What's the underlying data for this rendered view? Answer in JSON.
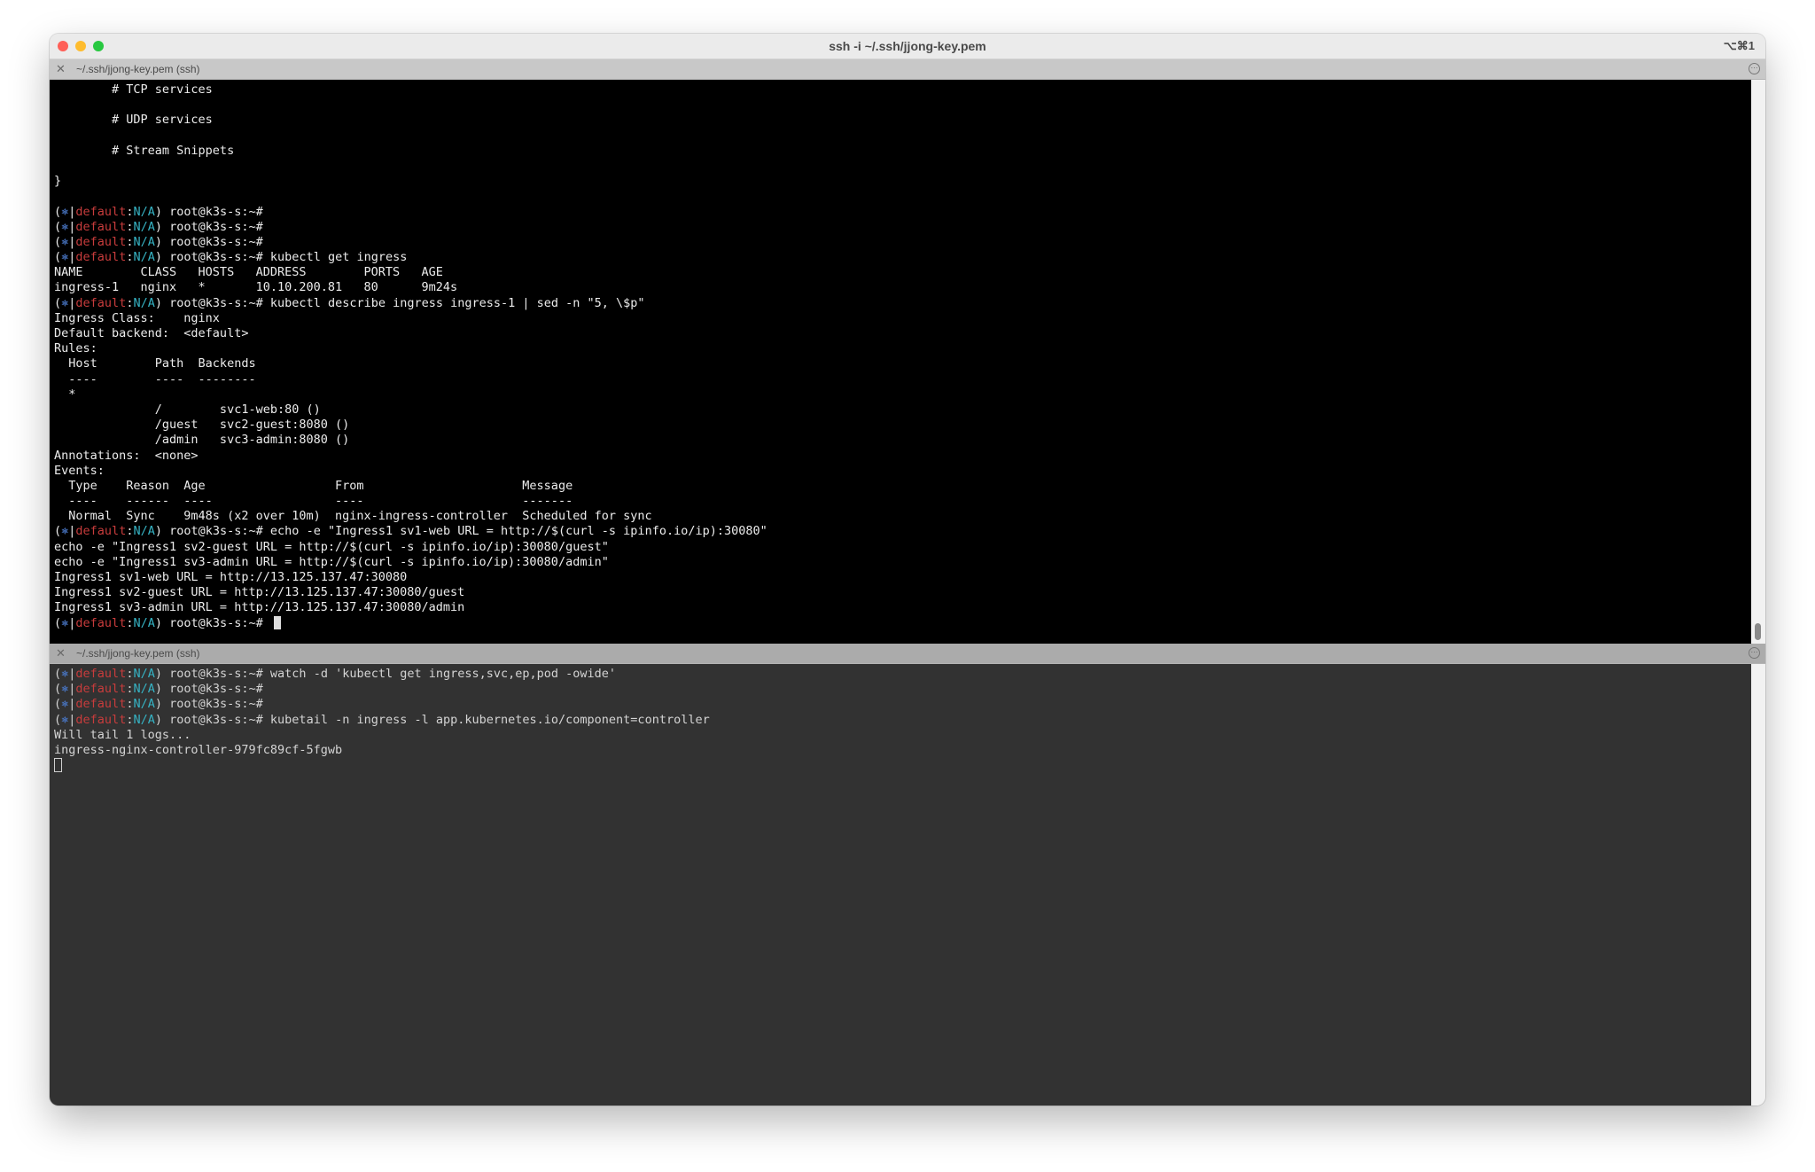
{
  "window": {
    "title": "ssh -i ~/.ssh/jjong-key.pem",
    "shortcut": "⌥⌘1"
  },
  "prompt": {
    "open": "(",
    "star": "⎈",
    "bar": "|",
    "context": "default",
    "colon": ":",
    "namespace": "N/A",
    "close": ")",
    "host": " root@k3s-s:~#"
  },
  "panes": [
    {
      "tab_label": "~/.ssh/jjong-key.pem (ssh)",
      "lines": [
        {
          "text": "        # TCP services"
        },
        {
          "text": ""
        },
        {
          "text": "        # UDP services"
        },
        {
          "text": ""
        },
        {
          "text": "        # Stream Snippets"
        },
        {
          "text": ""
        },
        {
          "text": "}"
        },
        {
          "text": ""
        },
        {
          "prompt": true,
          "text": ""
        },
        {
          "prompt": true,
          "text": ""
        },
        {
          "prompt": true,
          "text": ""
        },
        {
          "prompt": true,
          "text": " kubectl get ingress"
        },
        {
          "text": "NAME        CLASS   HOSTS   ADDRESS        PORTS   AGE"
        },
        {
          "text": "ingress-1   nginx   *       10.10.200.81   80      9m24s"
        },
        {
          "prompt": true,
          "text": " kubectl describe ingress ingress-1 | sed -n \"5, \\$p\""
        },
        {
          "text": "Ingress Class:    nginx"
        },
        {
          "text": "Default backend:  <default>"
        },
        {
          "text": "Rules:"
        },
        {
          "text": "  Host        Path  Backends"
        },
        {
          "text": "  ----        ----  --------"
        },
        {
          "text": "  *"
        },
        {
          "text": "              /        svc1-web:80 ()"
        },
        {
          "text": "              /guest   svc2-guest:8080 ()"
        },
        {
          "text": "              /admin   svc3-admin:8080 ()"
        },
        {
          "text": "Annotations:  <none>"
        },
        {
          "text": "Events:"
        },
        {
          "text": "  Type    Reason  Age                  From                      Message"
        },
        {
          "text": "  ----    ------  ----                 ----                      -------"
        },
        {
          "text": "  Normal  Sync    9m48s (x2 over 10m)  nginx-ingress-controller  Scheduled for sync"
        },
        {
          "prompt": true,
          "text": " echo -e \"Ingress1 sv1-web URL = http://$(curl -s ipinfo.io/ip):30080\""
        },
        {
          "text": "echo -e \"Ingress1 sv2-guest URL = http://$(curl -s ipinfo.io/ip):30080/guest\""
        },
        {
          "text": "echo -e \"Ingress1 sv3-admin URL = http://$(curl -s ipinfo.io/ip):30080/admin\""
        },
        {
          "text": "Ingress1 sv1-web URL = http://13.125.137.47:30080"
        },
        {
          "text": "Ingress1 sv2-guest URL = http://13.125.137.47:30080/guest"
        },
        {
          "text": "Ingress1 sv3-admin URL = http://13.125.137.47:30080/admin"
        },
        {
          "prompt": true,
          "text": " ",
          "cursor": "block"
        }
      ]
    },
    {
      "tab_label": "~/.ssh/jjong-key.pem (ssh)",
      "lines": [
        {
          "prompt": true,
          "text": " watch -d 'kubectl get ingress,svc,ep,pod -owide'"
        },
        {
          "prompt": true,
          "text": ""
        },
        {
          "prompt": true,
          "text": ""
        },
        {
          "prompt": true,
          "text": " kubetail -n ingress -l app.kubernetes.io/component=controller"
        },
        {
          "text": "Will tail 1 logs..."
        },
        {
          "text": "ingress-nginx-controller-979fc89cf-5fgwb"
        },
        {
          "text": "",
          "cursor": "hollow"
        }
      ]
    }
  ]
}
